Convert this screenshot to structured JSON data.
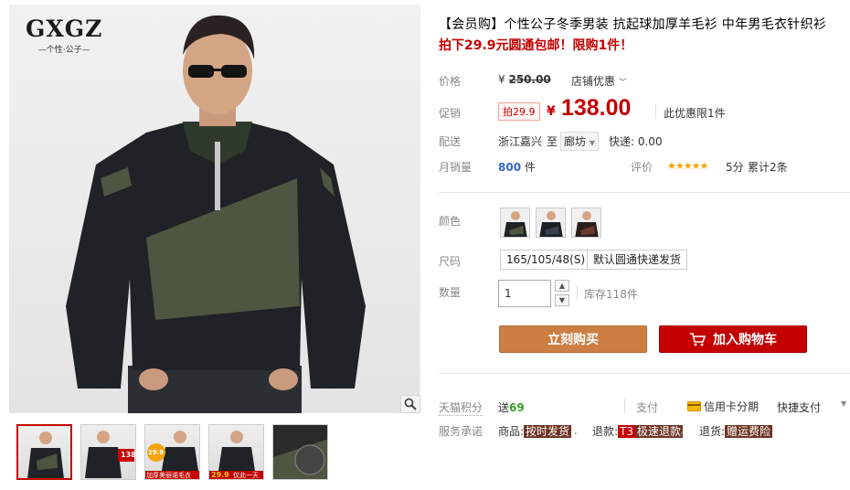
{
  "gallery": {
    "logo_main": "GXGZ",
    "logo_sub": "—个性·公子—",
    "thumbnail_captions": [
      "",
      "",
      "加厚美丽诺毛衣",
      "仅此一天",
      ""
    ],
    "thumbnail_badges": [
      "",
      "138",
      "29.9",
      "29.9",
      ""
    ]
  },
  "product": {
    "title": "【会员购】个性公子冬季男装 抗起球加厚羊毛衫 中年男毛衣针织衫",
    "promo_line": "拍下29.9元圆通包邮！限购1件！"
  },
  "price": {
    "label": "价格",
    "currency": "¥",
    "original": "250.00",
    "shop_discount": "店铺优惠"
  },
  "promo": {
    "label": "促销",
    "badge": "拍29.9",
    "currency": "¥",
    "price": "138.00",
    "limit_note": "此优惠限1件"
  },
  "delivery": {
    "label": "配送",
    "from": "浙江嘉兴",
    "to_word": "至",
    "destination": "廊坊",
    "shipping": "快递: 0.00"
  },
  "sales": {
    "label": "月销量",
    "count": "800",
    "unit": "件",
    "rating_label": "评价",
    "stars": "★★★★★",
    "score": "5分",
    "reviews": "累计2条"
  },
  "options": {
    "color_label": "颜色",
    "size_label": "尺码",
    "sizes": [
      "165/105/48(S)",
      "默认圆通快递发货"
    ],
    "qty_label": "数量",
    "qty_value": "1",
    "stock": "库存118件"
  },
  "actions": {
    "buy_now": "立刻购买",
    "add_cart": "加入购物车"
  },
  "services": {
    "points_label": "天猫积分",
    "points_prefix": "送",
    "points_value": "69",
    "pay_label": "支付",
    "credit": "信用卡分期",
    "quick_pay": "快捷支付",
    "promise_label": "服务承诺",
    "goods_prefix": "商品:",
    "goods_tag": "按时发货",
    "refund_prefix": "退款:",
    "refund_t3": "T3",
    "refund_tag": "极速退款",
    "return_prefix": "退货:",
    "return_tag": "赠运费险"
  },
  "colors": {
    "accent": "#c40000",
    "buy_button": "#cc7e43",
    "stars": "#f2a30c"
  }
}
